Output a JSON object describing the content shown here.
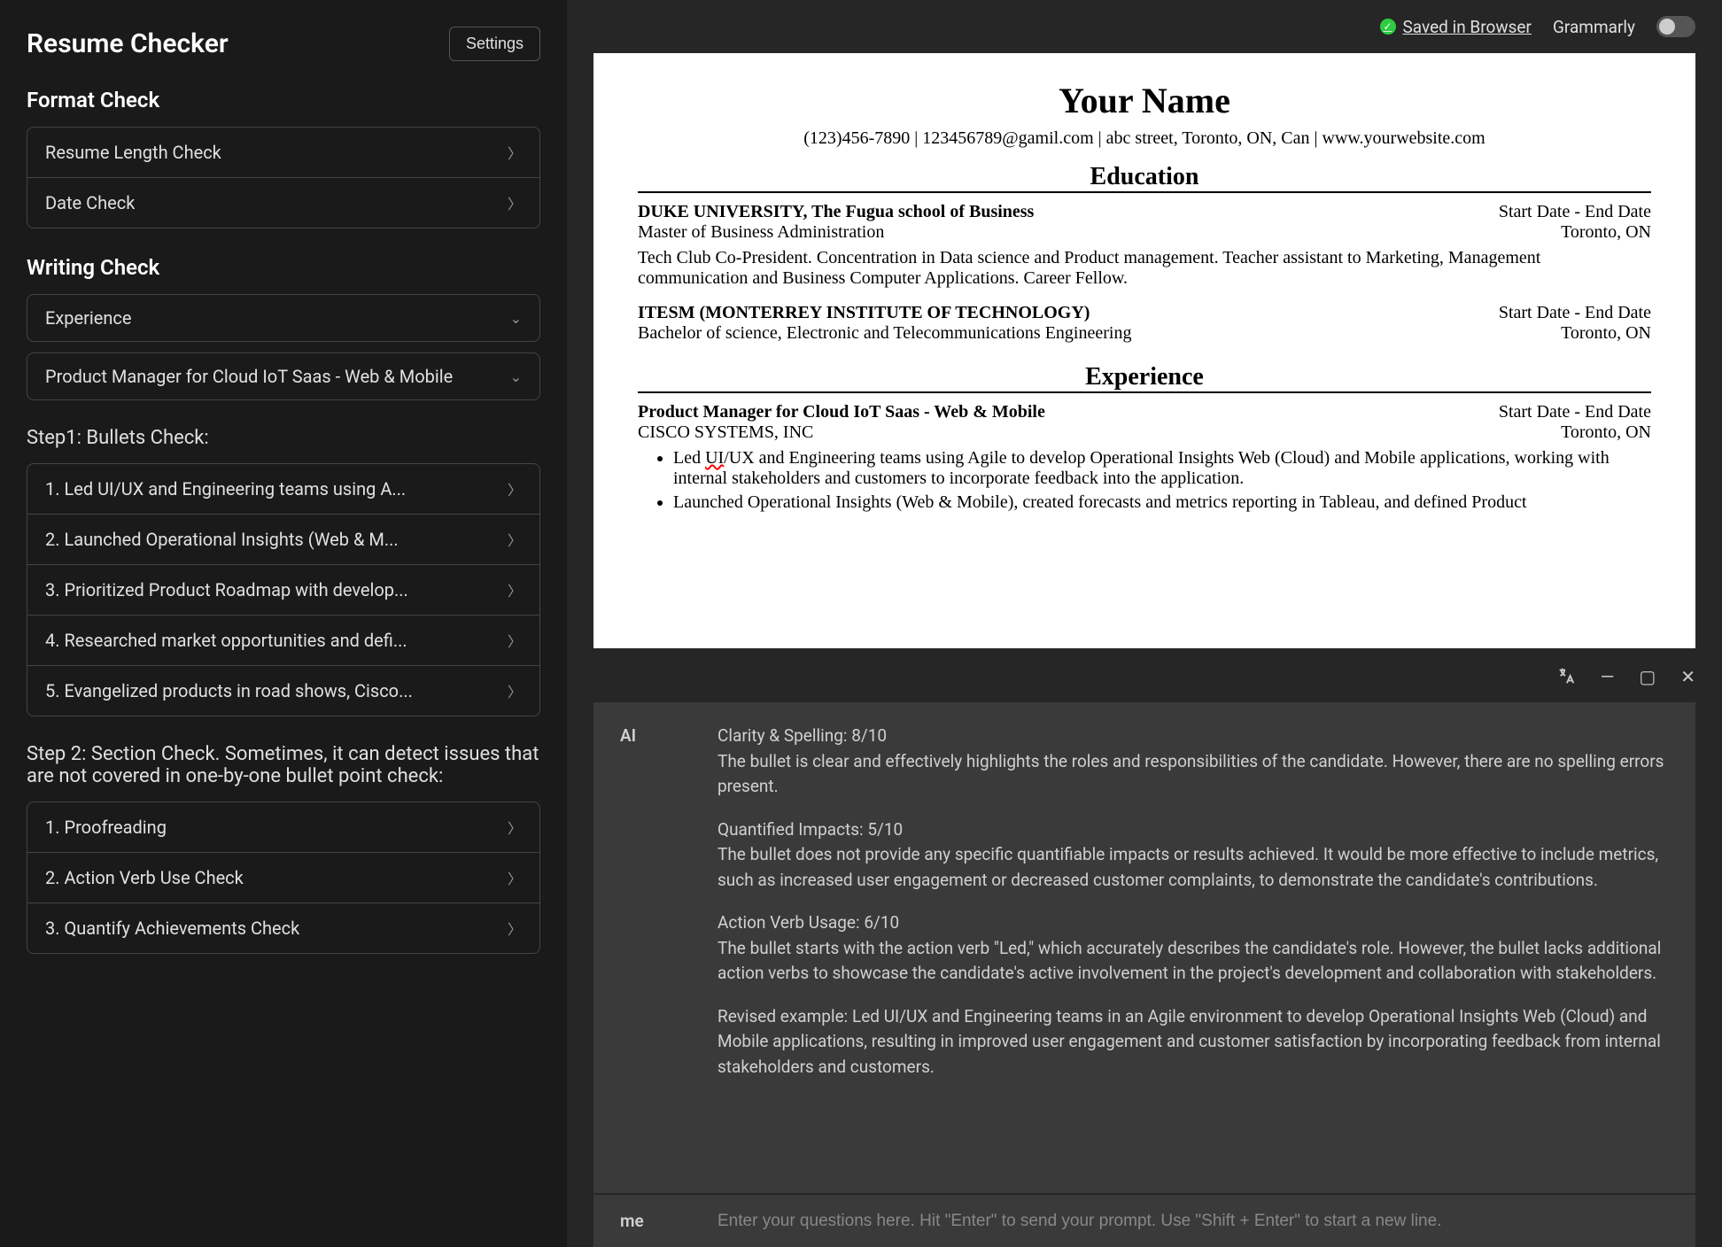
{
  "app": {
    "title": "Resume Checker",
    "settings_label": "Settings"
  },
  "format_check": {
    "title": "Format Check",
    "items": [
      {
        "label": "Resume Length Check"
      },
      {
        "label": "Date Check"
      }
    ]
  },
  "writing_check": {
    "title": "Writing Check",
    "dropdown1": "Experience",
    "dropdown2": "Product Manager for Cloud IoT Saas - Web & Mobile"
  },
  "step1": {
    "title": "Step1: Bullets Check:",
    "items": [
      {
        "label": "1. Led UI/UX and Engineering teams using A..."
      },
      {
        "label": "2. Launched Operational Insights (Web & M..."
      },
      {
        "label": "3. Prioritized Product Roadmap with develop..."
      },
      {
        "label": "4. Researched market opportunities and defi..."
      },
      {
        "label": "5. Evangelized products in road shows, Cisco..."
      }
    ]
  },
  "step2": {
    "title": "Step 2: Section Check. Sometimes, it can detect issues that are not covered in one-by-one bullet point check:",
    "items": [
      {
        "label": "1. Proofreading"
      },
      {
        "label": "2. Action Verb Use Check"
      },
      {
        "label": "3. Quantify Achievements Check"
      }
    ]
  },
  "topbar": {
    "saved": "Saved in Browser",
    "grammarly": "Grammarly"
  },
  "resume": {
    "name": "Your Name",
    "contact": "(123)456-7890 | 123456789@gamil.com | abc street, Toronto, ON, Can | www.yourwebsite.com",
    "education_header": "Education",
    "edu1_left": "DUKE UNIVERSITY, The Fugua school of Business",
    "edu1_right": "Start Date - End Date",
    "edu1_degree": "Master of Business Administration",
    "edu1_loc": "Toronto, ON",
    "edu1_body": "Tech Club Co-President. Concentration in Data science and Product management. Teacher assistant to Marketing, Management communication and Business Computer Applications. Career Fellow.",
    "edu2_left": "ITESM (MONTERREY INSTITUTE OF TECHNOLOGY)",
    "edu2_right": "Start Date - End Date",
    "edu2_degree": "Bachelor of science, Electronic and Telecommunications Engineering",
    "edu2_loc": "Toronto, ON",
    "experience_header": "Experience",
    "exp1_left": "Product Manager for Cloud IoT Saas - Web & Mobile",
    "exp1_right": "Start Date - End Date",
    "exp1_company": "CISCO SYSTEMS, INC",
    "exp1_loc": "Toronto, ON",
    "exp1_bullet1_pre": "Led ",
    "exp1_bullet1_ui": "UI",
    "exp1_bullet1_post": "/UX and Engineering teams using Agile to develop Operational Insights Web (Cloud) and Mobile applications, working with internal stakeholders and customers to incorporate feedback into the application.",
    "exp1_bullet2": "Launched Operational Insights (Web & Mobile), created forecasts and metrics reporting in Tableau, and defined Product"
  },
  "ai": {
    "speaker": "AI",
    "clarity_head": "Clarity & Spelling: 8/10",
    "clarity_body": "The bullet is clear and effectively highlights the roles and responsibilities of the candidate. However, there are no spelling errors present.",
    "quant_head": "Quantified Impacts: 5/10",
    "quant_body": "The bullet does not provide any specific quantifiable impacts or results achieved. It would be more effective to include metrics, such as increased user engagement or decreased customer complaints, to demonstrate the candidate's contributions.",
    "verb_head": "Action Verb Usage: 6/10",
    "verb_body": "The bullet starts with the action verb \"Led,\" which accurately describes the candidate's role. However, the bullet lacks additional action verbs to showcase the candidate's active involvement in the project's development and collaboration with stakeholders.",
    "revised": "Revised example: Led UI/UX and Engineering teams in an Agile environment to develop Operational Insights Web (Cloud) and Mobile applications, resulting in improved user engagement and customer satisfaction by incorporating feedback from internal stakeholders and customers.",
    "me_label": "me",
    "input_placeholder": "Enter your questions here. Hit \"Enter\" to send your prompt. Use \"Shift + Enter\" to start a new line."
  }
}
